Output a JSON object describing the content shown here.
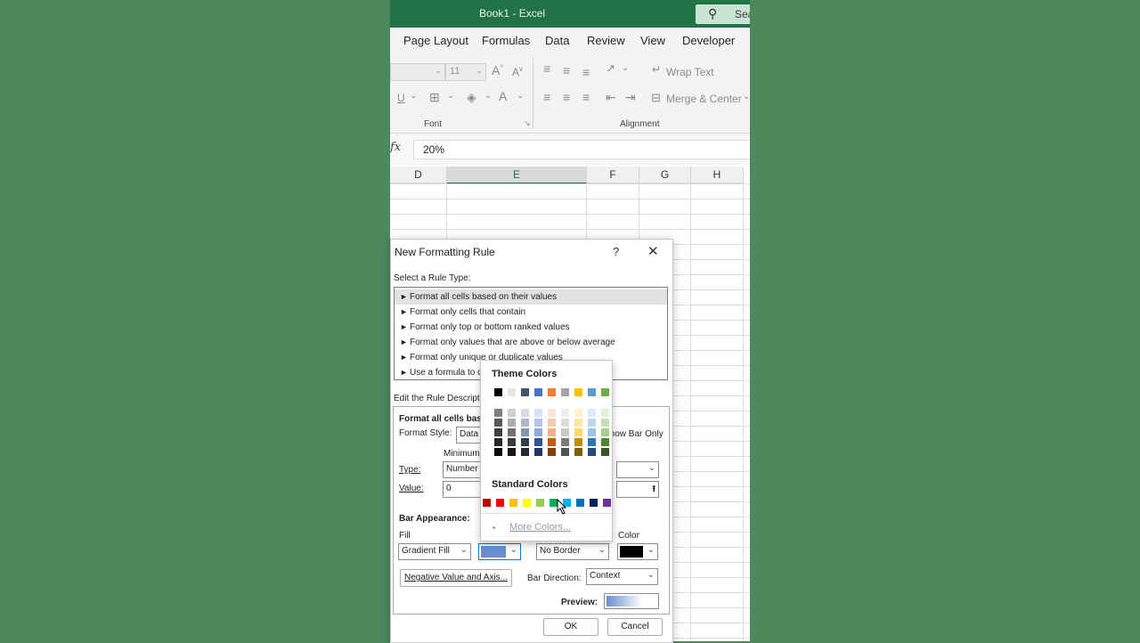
{
  "window": {
    "title": "Book1  -  Excel",
    "search_label": "Sea"
  },
  "ribbon_tabs": [
    "Page Layout",
    "Formulas",
    "Data",
    "Review",
    "View",
    "Developer"
  ],
  "ribbon": {
    "font_size": "11",
    "wrap_text": "Wrap Text",
    "merge_center": "Merge & Center",
    "group_font": "Font",
    "group_alignment": "Alignment"
  },
  "formula_bar": {
    "fx": "fx",
    "value": "20%"
  },
  "columns": [
    "D",
    "E",
    "F",
    "G",
    "H"
  ],
  "dialog": {
    "title": "New Formatting Rule",
    "help": "?",
    "close": "✕",
    "rule_type_label": "Select a Rule Type:",
    "rule_types": [
      "Format all cells based on their values",
      "Format only cells that contain",
      "Format only top or bottom ranked values",
      "Format only values that are above or below average",
      "Format only unique or duplicate values",
      "Use a formula to determine which cells to format"
    ],
    "edit_label": "Edit the Rule Description:",
    "format_all_label": "Format all cells based on their values:",
    "format_style_label": "Format Style:",
    "format_style_value": "Data Bar",
    "show_bar_only": "Show Bar Only",
    "minimum_label": "Minimum",
    "type_label": "Type:",
    "type_value": "Number",
    "value_label": "Value:",
    "value_value": "0",
    "bar_appearance_label": "Bar Appearance:",
    "fill_label": "Fill",
    "fill_value": "Gradient Fill",
    "border_value": "No Border",
    "color_label": "Color",
    "negative_button": "Negative Value and Axis...",
    "bar_direction_label": "Bar Direction:",
    "bar_direction_value": "Context",
    "preview_label": "Preview:",
    "ok": "OK",
    "cancel": "Cancel",
    "fill_color": "#6b8fce",
    "border_color": "#000000"
  },
  "color_picker": {
    "theme_label": "Theme Colors",
    "standard_label": "Standard Colors",
    "more_colors": "More Colors...",
    "theme_colors": [
      "#000000",
      "#e7e6e6",
      "#44546a",
      "#4472c4",
      "#ed7d31",
      "#a5a5a5",
      "#ffc000",
      "#5b9bd5",
      "#70ad47"
    ],
    "theme_shades": [
      [
        "#7f7f7f",
        "#595959",
        "#3f3f3f",
        "#262626",
        "#0d0d0d"
      ],
      [
        "#d0cece",
        "#aeabab",
        "#757171",
        "#3a3838",
        "#171616"
      ],
      [
        "#d6dce4",
        "#acb9ca",
        "#8497b0",
        "#333f4f",
        "#222a35"
      ],
      [
        "#d9e2f3",
        "#b4c6e7",
        "#8eaadb",
        "#2f5496",
        "#1f3864"
      ],
      [
        "#fbe5d5",
        "#f7cbac",
        "#f4b183",
        "#c55a11",
        "#833c0b"
      ],
      [
        "#ededed",
        "#dbdbdb",
        "#c9c9c9",
        "#7b7b7b",
        "#525252"
      ],
      [
        "#fff2cc",
        "#fee599",
        "#ffd966",
        "#bf8f00",
        "#7f6000"
      ],
      [
        "#deebf6",
        "#bdd7ee",
        "#9dc3e6",
        "#2e75b5",
        "#1f4e79"
      ],
      [
        "#e2efd9",
        "#c5e0b3",
        "#a8d08d",
        "#538135",
        "#375623"
      ]
    ],
    "standard_colors": [
      "#c00000",
      "#ff0000",
      "#ffc000",
      "#ffff00",
      "#92d050",
      "#00b050",
      "#00b0f0",
      "#0070c0",
      "#002060",
      "#7030a0"
    ]
  }
}
